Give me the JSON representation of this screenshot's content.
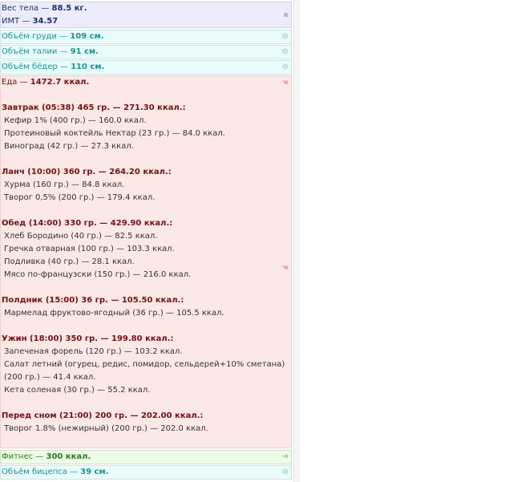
{
  "weight": {
    "label": "Вес тела",
    "value": "88.5 кг.",
    "bmi_label": "ИМТ",
    "bmi_value": "34.57",
    "icon": "lock-icon"
  },
  "measurements": [
    {
      "label": "Объём груди",
      "value": "109 см."
    },
    {
      "label": "Объём талии",
      "value": "91 см."
    },
    {
      "label": "Объём бёдер",
      "value": "110 см."
    }
  ],
  "food": {
    "label": "Еда",
    "total": "1472.7 ккал.",
    "meals": [
      {
        "title": "Завтрак (05:38) 465 гр. — 271.30 ккал.:",
        "items": [
          "Кефир 1% (400 гр.) — 160.0 ккал.",
          "Протеиновый коктейль Нектар (23 гр.) — 84.0 ккал.",
          "Виноград (42 гр.) — 27.3 ккал."
        ]
      },
      {
        "title": "Ланч (10:00) 360 гр. — 264.20 ккал.:",
        "items": [
          "Хурма (160 гр.) — 84.8 ккал.",
          "Творог 0,5% (200 гр.) — 179.4 ккал."
        ]
      },
      {
        "title": "Обед (14:00) 330 гр. — 429.90 ккал.:",
        "items": [
          "Хлеб Бородино (40 гр.) — 82.5 ккал.",
          "Гречка отварная (100 гр.) — 103.3 ккал.",
          "Подливка (40 гр.) — 28.1 ккал.",
          "Мясо по-французски (150 гр.) — 216.0 ккал."
        ]
      },
      {
        "title": "Полдник (15:00) 36 гр. — 105.50 ккал.:",
        "items": [
          "Мармелад фруктово-ягодный (36 гр.) — 105.5 ккал."
        ]
      },
      {
        "title": "Ужин (18:00) 350 гр. — 199.80 ккал.:",
        "items": [
          "Запеченая форель (120 гр.) — 103.2 ккал.",
          "Салат летний (огурец, редис, помидор, сельдерей+10% сметана) (200 гр.) — 41.4 ккал.",
          "Кета соленая (30 гр.) — 55.2 ккал."
        ]
      },
      {
        "title": "Перед сном (21:00) 200 гр. — 202.00 ккал.:",
        "items": [
          "Творог 1.8% (нежирный) (200 гр.) — 202.0 ккал."
        ]
      }
    ]
  },
  "fitness": {
    "label": "Фитнес",
    "value": "300 ккал."
  },
  "biceps": {
    "label": "Объём бицепса",
    "value": "39 см."
  }
}
